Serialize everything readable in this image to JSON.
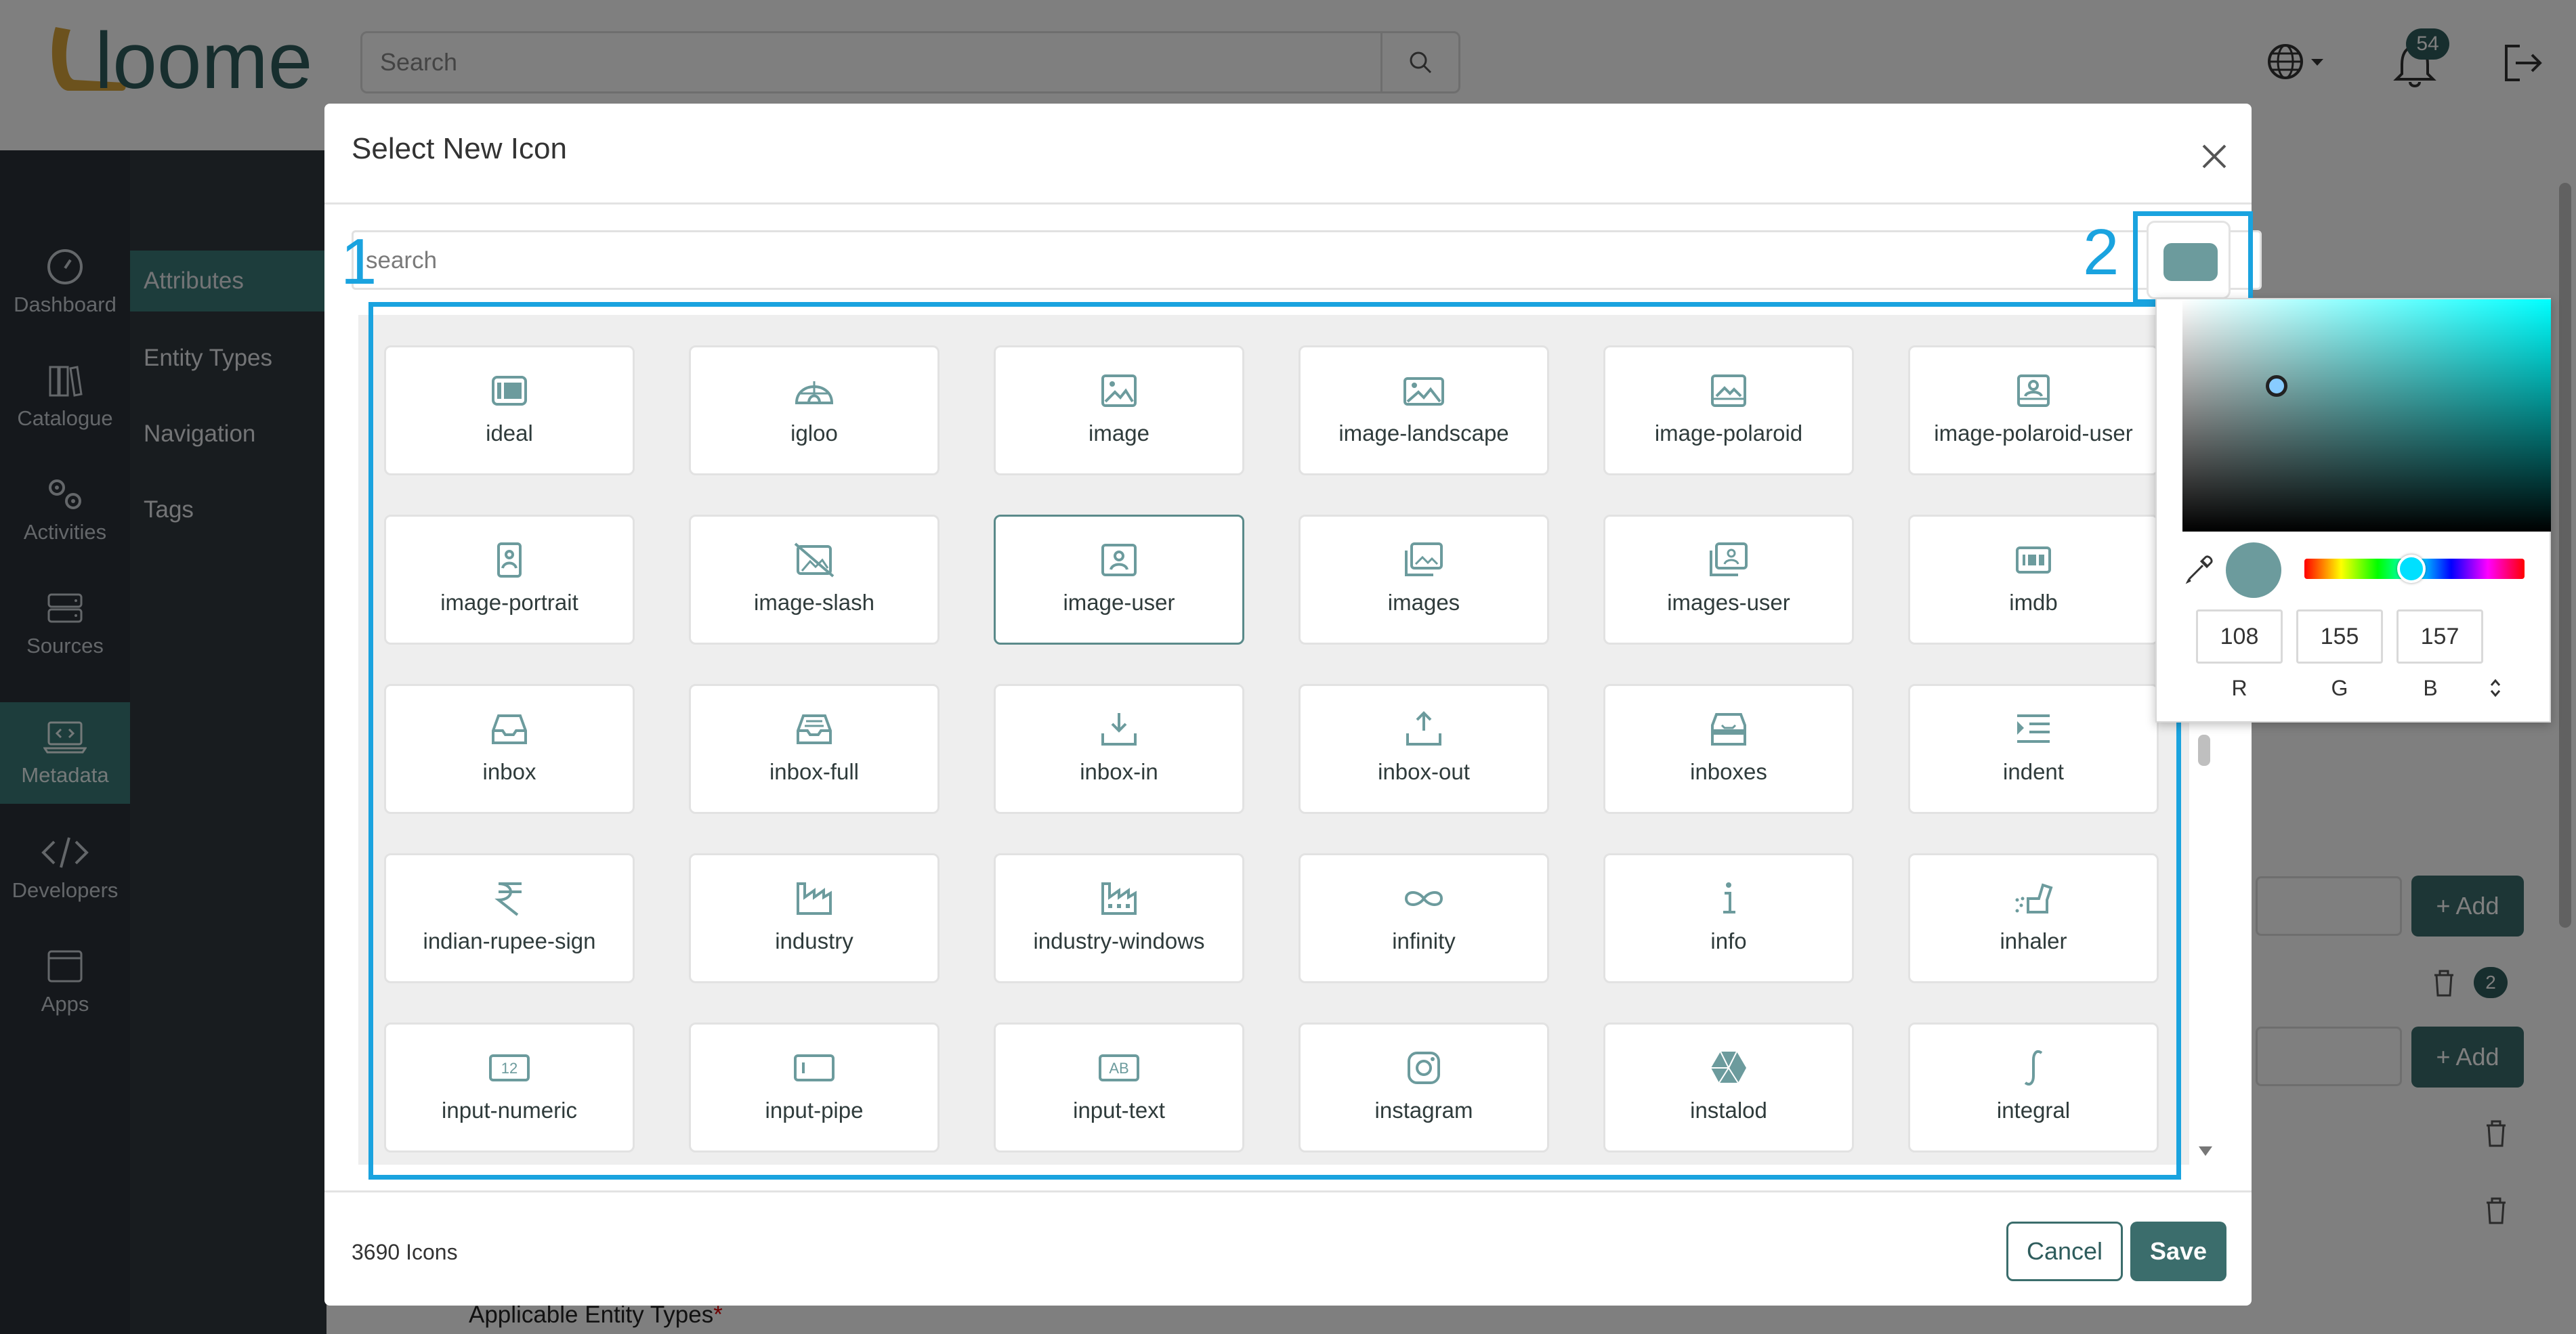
{
  "app": {
    "brand": "loome",
    "search_placeholder": "Search",
    "notification_count": "54"
  },
  "sidebar": {
    "items": [
      {
        "label": "Dashboard",
        "icon": "dashboard-gauge-icon"
      },
      {
        "label": "Catalogue",
        "icon": "books-icon"
      },
      {
        "label": "Activities",
        "icon": "gears-icon"
      },
      {
        "label": "Sources",
        "icon": "server-icon"
      },
      {
        "label": "Metadata",
        "icon": "laptop-code-icon"
      },
      {
        "label": "Developers",
        "icon": "code-icon"
      },
      {
        "label": "Apps",
        "icon": "window-icon"
      }
    ],
    "active": "Metadata"
  },
  "subnav": {
    "items": [
      {
        "label": "Attributes"
      },
      {
        "label": "Entity Types"
      },
      {
        "label": "Navigation"
      },
      {
        "label": "Tags"
      }
    ],
    "active": "Attributes"
  },
  "background_page": {
    "add_label": "+ Add",
    "badge_count": "2",
    "applicable_label": "Applicable Entity Types",
    "required_marker": "*"
  },
  "modal": {
    "title": "Select New Icon",
    "search_placeholder": "search",
    "icon_count_label": "3690 Icons",
    "cancel_label": "Cancel",
    "save_label": "Save",
    "selected_icon": "image-user",
    "icons": [
      {
        "label": "ideal"
      },
      {
        "label": "igloo"
      },
      {
        "label": "image"
      },
      {
        "label": "image-landscape"
      },
      {
        "label": "image-polaroid"
      },
      {
        "label": "image-polaroid-user"
      },
      {
        "label": "image-portrait"
      },
      {
        "label": "image-slash"
      },
      {
        "label": "image-user"
      },
      {
        "label": "images"
      },
      {
        "label": "images-user"
      },
      {
        "label": "imdb"
      },
      {
        "label": "inbox"
      },
      {
        "label": "inbox-full"
      },
      {
        "label": "inbox-in"
      },
      {
        "label": "inbox-out"
      },
      {
        "label": "inboxes"
      },
      {
        "label": "indent"
      },
      {
        "label": "indian-rupee-sign"
      },
      {
        "label": "industry"
      },
      {
        "label": "industry-windows"
      },
      {
        "label": "infinity"
      },
      {
        "label": "info"
      },
      {
        "label": "inhaler"
      },
      {
        "label": "input-numeric"
      },
      {
        "label": "input-pipe"
      },
      {
        "label": "input-text"
      },
      {
        "label": "instagram"
      },
      {
        "label": "instalod"
      },
      {
        "label": "integral"
      }
    ]
  },
  "color_picker": {
    "selected_color": "#6c9b9d",
    "r": "108",
    "g": "155",
    "b": "157",
    "r_label": "R",
    "g_label": "G",
    "b_label": "B"
  },
  "annotations": {
    "one": "1",
    "two": "2",
    "color": "#1aa3df"
  },
  "colors": {
    "accent": "#3b6d6c",
    "sidebar_bg": "#2a3038",
    "active_nav": "#3b7a78"
  }
}
